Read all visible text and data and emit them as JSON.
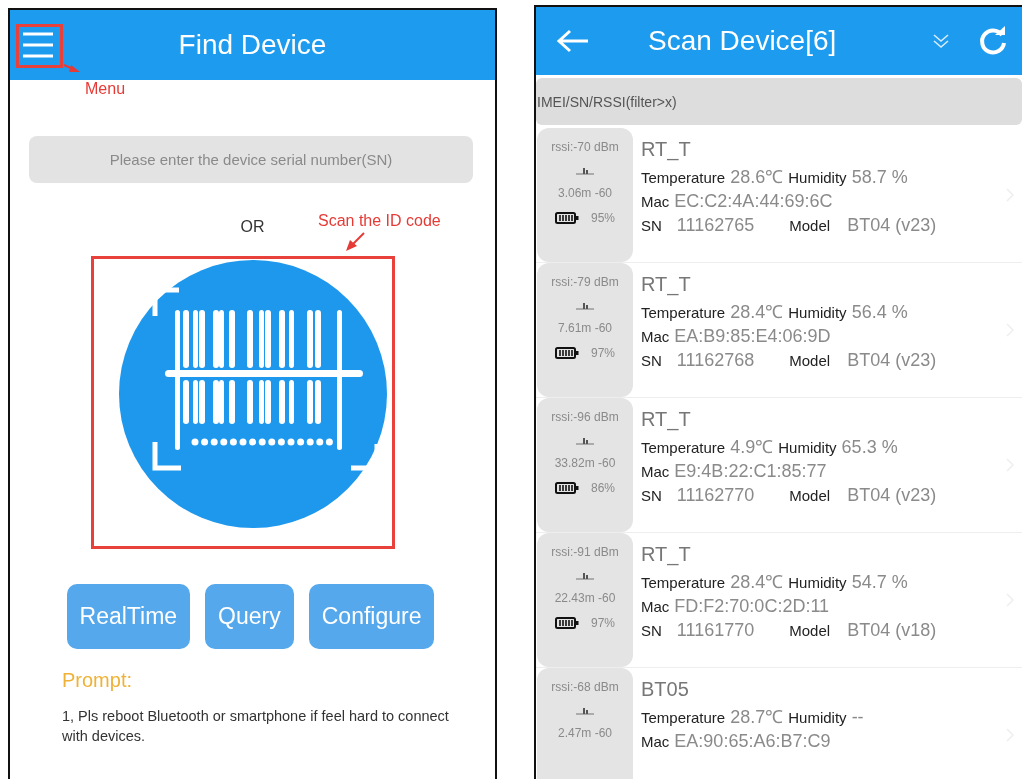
{
  "find_screen": {
    "header": {
      "title": "Find Device"
    },
    "search": {
      "placeholder": "Please enter the device serial number(SN)"
    },
    "separator": "OR",
    "buttons": [
      "RealTime",
      "Query",
      "Configure"
    ],
    "prompt": {
      "title": "Prompt:",
      "items": [
        "1, Pls reboot Bluetooth or smartphone if feel hard to connect with devices."
      ]
    }
  },
  "annotations": [
    {
      "kind": "menu",
      "label": "Menu"
    },
    {
      "kind": "scan",
      "label": "Scan the ID code"
    }
  ],
  "scan_screen": {
    "header": {
      "title": "Scan Device[6]"
    },
    "filter": {
      "placeholder": "IMEI/SN/RSSI(filter>x)"
    },
    "devices": [
      {
        "rssi": "rssi:-70 dBm",
        "distance": "3.06m -60",
        "battery": "95%",
        "name": "RT_T",
        "temperature_label": "Temperature",
        "temperature": "28.6℃",
        "humidity_label": "Humidity",
        "humidity": "58.7 %",
        "mac_label": "Mac",
        "mac": "EC:C2:4A:44:69:6C",
        "sn_label": "SN",
        "sn": "11162765",
        "model_label": "Model",
        "model": "BT04 (v23)"
      },
      {
        "rssi": "rssi:-79 dBm",
        "distance": "7.61m -60",
        "battery": "97%",
        "name": "RT_T",
        "temperature_label": "Temperature",
        "temperature": "28.4℃",
        "humidity_label": "Humidity",
        "humidity": "56.4 %",
        "mac_label": "Mac",
        "mac": "EA:B9:85:E4:06:9D",
        "sn_label": "SN",
        "sn": "11162768",
        "model_label": "Model",
        "model": "BT04 (v23)"
      },
      {
        "rssi": "rssi:-96 dBm",
        "distance": "33.82m -60",
        "battery": "86%",
        "name": "RT_T",
        "temperature_label": "Temperature",
        "temperature": "4.9℃",
        "humidity_label": "Humidity",
        "humidity": "65.3 %",
        "mac_label": "Mac",
        "mac": "E9:4B:22:C1:85:77",
        "sn_label": "SN",
        "sn": "11162770",
        "model_label": "Model",
        "model": "BT04 (v23)"
      },
      {
        "rssi": "rssi:-91 dBm",
        "distance": "22.43m -60",
        "battery": "97%",
        "name": "RT_T",
        "temperature_label": "Temperature",
        "temperature": "28.4℃",
        "humidity_label": "Humidity",
        "humidity": "54.7 %",
        "mac_label": "Mac",
        "mac": "FD:F2:70:0C:2D:11",
        "sn_label": "SN",
        "sn": "11161770",
        "model_label": "Model",
        "model": "BT04 (v18)"
      },
      {
        "rssi": "rssi:-68 dBm",
        "distance": "2.47m -60",
        "name": "BT05",
        "temperature_label": "Temperature",
        "temperature": "28.7℃",
        "humidity_label": "Humidity",
        "humidity": "--",
        "mac_label": "Mac",
        "mac": "EA:90:65:A6:B7:C9"
      }
    ]
  }
}
